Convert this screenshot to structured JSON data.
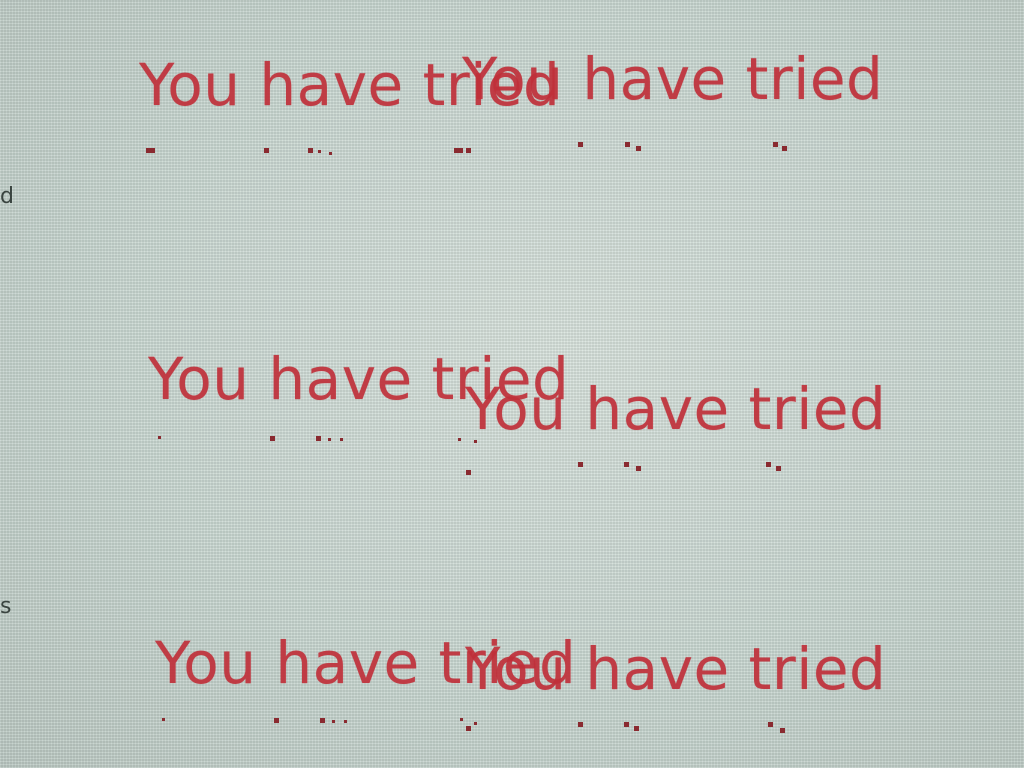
{
  "colors": {
    "message": "#c0303a",
    "dots": "#8a2a30",
    "background": "#cfdcd6",
    "edge_text": "#3a4440"
  },
  "messages": [
    {
      "text": "You have tried"
    },
    {
      "text": "You have tried"
    },
    {
      "text": "You have tried"
    },
    {
      "text": "You have tried"
    },
    {
      "text": "You have tried"
    },
    {
      "text": "You have tried"
    }
  ],
  "edge_glyphs": [
    {
      "text": "d"
    },
    {
      "text": "s"
    }
  ]
}
